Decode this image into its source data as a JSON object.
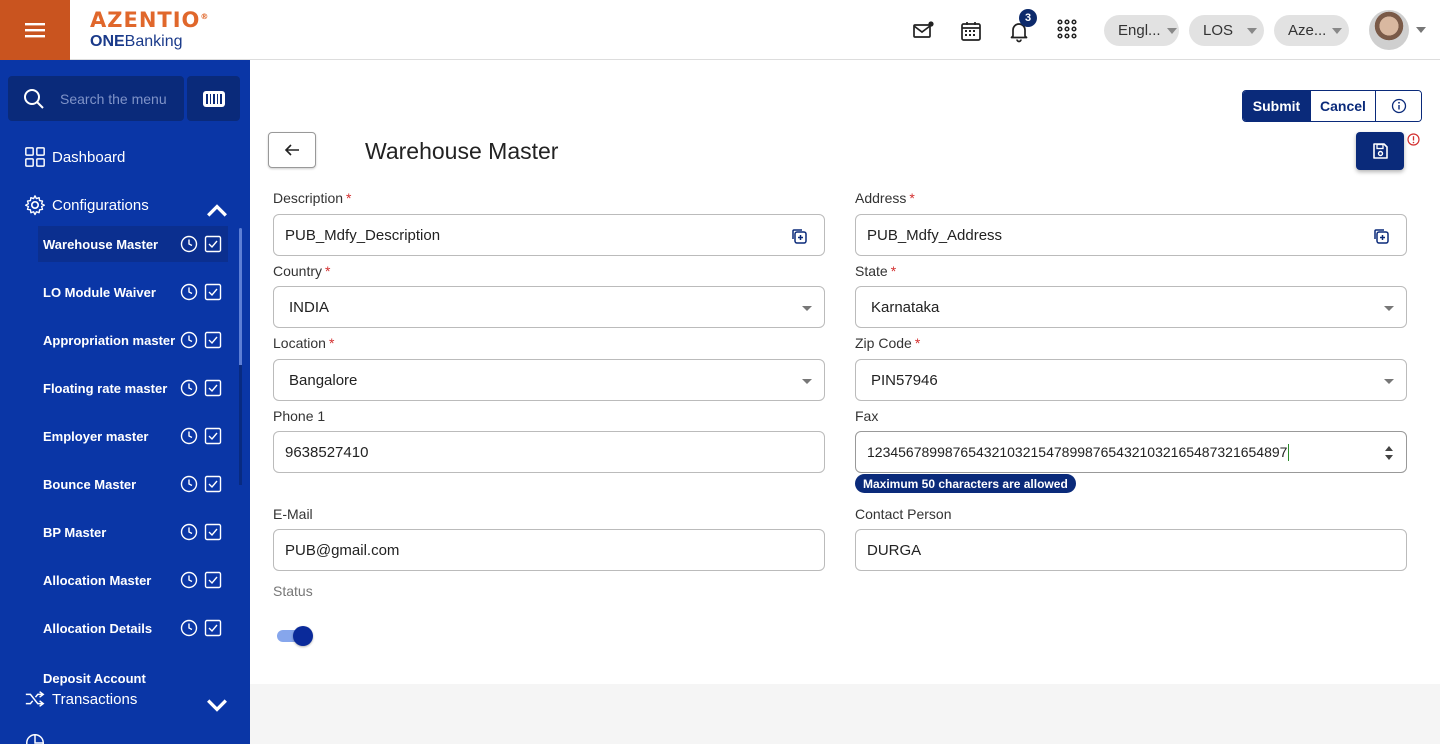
{
  "header": {
    "brand": "AZENTIO",
    "brand_tm": "®",
    "product_bold": "ONE",
    "product_rest": "Banking",
    "notification_count": "3",
    "language": "Engl...",
    "module": "LOS",
    "entity": "Aze..."
  },
  "sidebar": {
    "search_placeholder": "Search the menu",
    "dashboard": "Dashboard",
    "configurations": "Configurations",
    "transactions": "Transactions",
    "items": [
      {
        "label": "Warehouse Master"
      },
      {
        "label": "LO Module Waiver"
      },
      {
        "label": "Appropriation master"
      },
      {
        "label": "Floating rate master"
      },
      {
        "label": "Employer master"
      },
      {
        "label": "Bounce Master"
      },
      {
        "label": "BP Master"
      },
      {
        "label": "Allocation Master"
      },
      {
        "label": "Allocation Details"
      },
      {
        "label": "Deposit Account"
      }
    ]
  },
  "actions": {
    "submit": "Submit",
    "cancel": "Cancel"
  },
  "page": {
    "title": "Warehouse Master"
  },
  "form": {
    "description": {
      "label": "Description",
      "value": "PUB_Mdfy_Description"
    },
    "address": {
      "label": "Address",
      "value": "PUB_Mdfy_Address"
    },
    "country": {
      "label": "Country",
      "value": "INDIA"
    },
    "state": {
      "label": "State",
      "value": "Karnataka"
    },
    "location": {
      "label": "Location",
      "value": "Bangalore"
    },
    "zip": {
      "label": "Zip Code",
      "value": "PIN57946"
    },
    "phone1": {
      "label": "Phone 1",
      "value": "9638527410"
    },
    "fax": {
      "label": "Fax",
      "value": "12345678998765432103215478998765432103216548732165489​7",
      "hint": "Maximum 50 characters are allowed"
    },
    "email": {
      "label": "E-Mail",
      "value": "PUB@gmail.com"
    },
    "contact": {
      "label": "Contact Person",
      "value": "DURGA"
    },
    "status": {
      "label": "Status",
      "enabled": true
    },
    "required_mark": "*"
  },
  "colors": {
    "sidebar": "#0a36a6",
    "primary": "#0a2a7a",
    "accent": "#c9541f"
  }
}
